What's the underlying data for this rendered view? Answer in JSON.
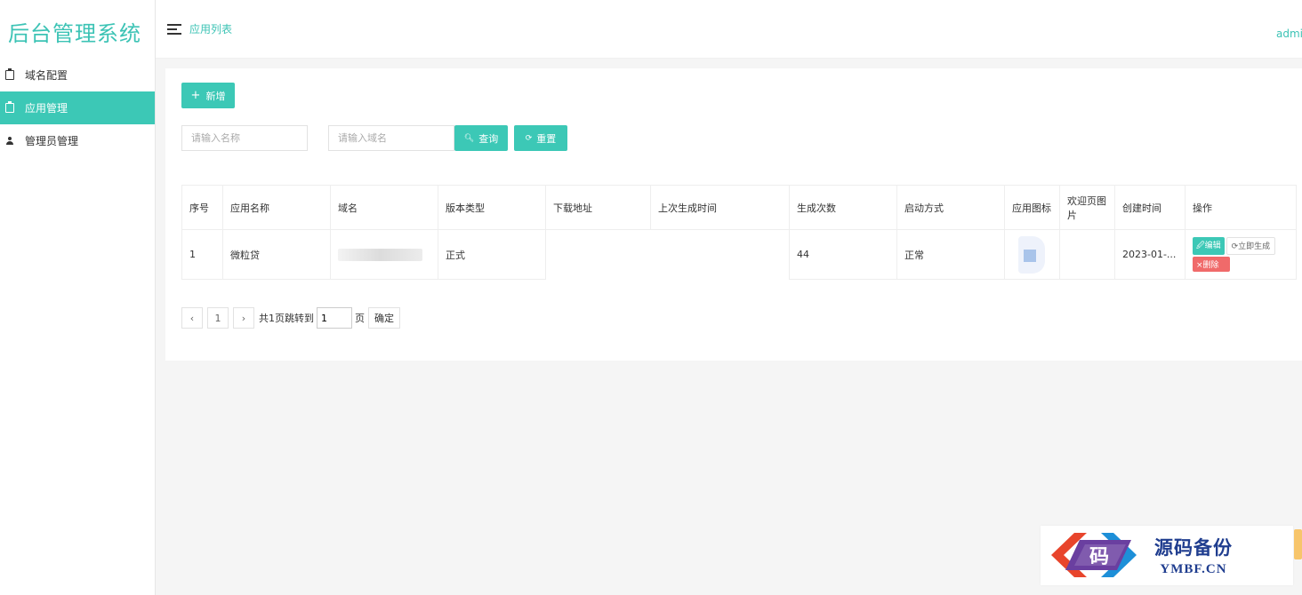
{
  "sidebar": {
    "logo": "后台管理系统",
    "items": [
      {
        "label": "域名配置",
        "icon": "clipboard-icon",
        "active": false
      },
      {
        "label": "应用管理",
        "icon": "clipboard-icon",
        "active": true
      },
      {
        "label": "管理员管理",
        "icon": "user-icon",
        "active": false
      }
    ]
  },
  "header": {
    "breadcrumb": "应用列表",
    "user": "admin"
  },
  "toolbar": {
    "add_label": "新增",
    "name_placeholder": "请输入名称",
    "domain_placeholder": "请输入域名",
    "search_label": "查询",
    "reset_label": "重置"
  },
  "table": {
    "columns": [
      "序号",
      "应用名称",
      "域名",
      "版本类型",
      "下载地址",
      "上次生成时间",
      "生成次数",
      "启动方式",
      "应用图标",
      "欢迎页图片",
      "创建时间",
      "操作"
    ],
    "rows": [
      {
        "index": "1",
        "name": "微粒贷",
        "domain": "",
        "version": "正式",
        "download": "",
        "last_time": "",
        "count": "44",
        "launch": "正常",
        "created": "2023-01-...",
        "actions": {
          "edit": "编辑",
          "generate": "立即生成",
          "delete": "删除"
        }
      }
    ]
  },
  "pagination": {
    "prev": "‹",
    "page": "1",
    "next": "›",
    "total_text": "共1页跳转到",
    "jump_value": "1",
    "page_suffix": "页",
    "confirm": "确定"
  },
  "watermark": {
    "logo_char": "码",
    "cn": "源码备份",
    "en": "YMBF.CN"
  },
  "colors": {
    "accent": "#3cc8b6",
    "danger": "#f06a6a",
    "watermark_blue": "#1f3d8f"
  }
}
